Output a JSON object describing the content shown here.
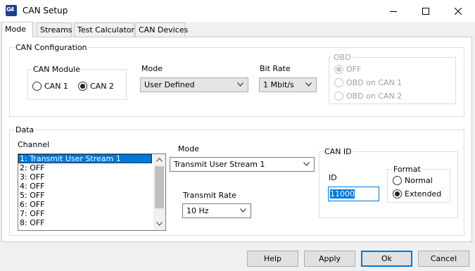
{
  "window": {
    "title": "CAN Setup",
    "icon_label": "G4"
  },
  "tabs": [
    {
      "label": "Mode",
      "active": true
    },
    {
      "label": "Streams",
      "active": false
    },
    {
      "label": "Test Calculator",
      "active": false
    },
    {
      "label": "CAN Devices",
      "active": false
    }
  ],
  "can_config": {
    "title": "CAN Configuration",
    "module": {
      "title": "CAN Module",
      "options": [
        {
          "label": "CAN 1",
          "selected": false
        },
        {
          "label": "CAN 2",
          "selected": true
        }
      ]
    },
    "mode": {
      "label": "Mode",
      "value": "User Defined"
    },
    "bitrate": {
      "label": "Bit Rate",
      "value": "1 Mbit/s"
    },
    "obd": {
      "title": "OBD",
      "options": [
        {
          "label": "OFF",
          "selected": true
        },
        {
          "label": "OBD on CAN 1",
          "selected": false
        },
        {
          "label": "OBD on CAN 2",
          "selected": false
        }
      ]
    }
  },
  "data": {
    "title": "Data",
    "channel": {
      "label": "Channel",
      "items": [
        "1: Transmit User Stream 1",
        "2: OFF",
        "3: OFF",
        "4: OFF",
        "5: OFF",
        "6: OFF",
        "7: OFF",
        "8: OFF"
      ],
      "selected_index": 0
    },
    "mode": {
      "label": "Mode",
      "value": "Transmit User Stream 1"
    },
    "transmit_rate": {
      "label": "Transmit Rate",
      "value": "10 Hz"
    },
    "can_id": {
      "title": "CAN ID",
      "id_label": "ID",
      "id_value": "11000",
      "format": {
        "title": "Format",
        "options": [
          {
            "label": "Normal",
            "selected": false
          },
          {
            "label": "Extended",
            "selected": true
          }
        ]
      }
    }
  },
  "buttons": {
    "help": "Help",
    "apply": "Apply",
    "ok": "Ok",
    "cancel": "Cancel"
  },
  "icons": {
    "minimize": "minimize-icon",
    "maximize": "maximize-icon",
    "close": "close-icon",
    "dropdown": "chevron-down-icon",
    "scroll_up": "chevron-up-icon",
    "scroll_down": "chevron-down-icon"
  }
}
